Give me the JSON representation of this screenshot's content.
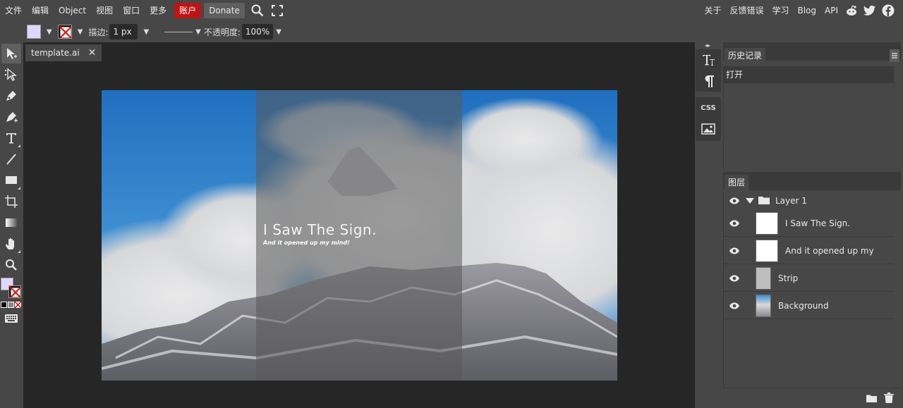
{
  "menu": {
    "file": "文件",
    "edit": "编辑",
    "object": "Object",
    "view": "视图",
    "window": "窗口",
    "more": "更多",
    "account": "账户",
    "donate": "Donate",
    "about": "关于",
    "feedback": "反馈错误",
    "learn": "学习",
    "blog": "Blog",
    "api": "API"
  },
  "options": {
    "stroke_label": "描边:",
    "stroke_value": "1 px",
    "opacity_label": "不透明度:",
    "opacity_value": "100%",
    "fill_color": "#ddd8ff"
  },
  "document": {
    "tab_name": "template.ai",
    "headline": "I Saw The Sign.",
    "subline": "And it opened up my mind!"
  },
  "history": {
    "tab_label": "历史记录",
    "items": [
      "打开"
    ]
  },
  "layers": {
    "tab_label": "图层",
    "group_name": "Layer 1",
    "items": [
      {
        "name": "I Saw The Sign."
      },
      {
        "name": "And it opened up my"
      },
      {
        "name": "Strip"
      },
      {
        "name": "Background"
      }
    ]
  },
  "mini_panel": {
    "css_label": "CSS"
  },
  "colors": {
    "account_bg": "#c01414",
    "ui_bg": "#474747",
    "workspace_bg": "#262626"
  }
}
